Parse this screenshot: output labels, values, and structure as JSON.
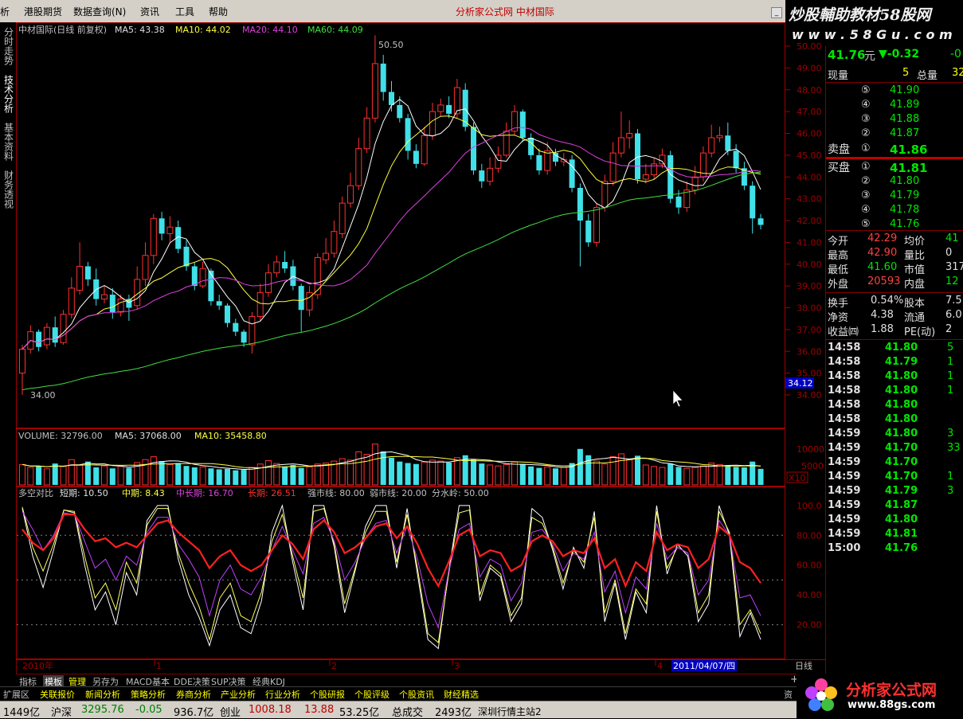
{
  "menu": {
    "items": [
      "析",
      "港股期货",
      "数据查询(N)",
      "资讯",
      "工具",
      "帮助"
    ],
    "center_title": "分析家公式网  中材国际"
  },
  "watermark": {
    "title": "炒股輔助教材58股网",
    "url": "w w w . 5 8 G u . c o m"
  },
  "side_tabs": [
    "分时走势",
    "技术分析",
    "基本资料",
    "财务透视"
  ],
  "main_chart": {
    "header": {
      "name": "中材国际(日线 前复权)",
      "ma5": "MA5: 43.38",
      "ma10": "MA10: 44.02",
      "ma20": "MA20: 44.10",
      "ma60": "MA60: 44.09"
    },
    "high_label": "50.50",
    "low_label": "34.00",
    "cursor_price": "34.12",
    "y_ticks": [
      "50.00",
      "49.00",
      "48.00",
      "47.00",
      "46.00",
      "45.00",
      "44.00",
      "43.00",
      "42.00",
      "41.00",
      "40.00",
      "39.00",
      "38.00",
      "37.00",
      "36.00",
      "35.00",
      "34.00"
    ]
  },
  "volume_chart": {
    "header": {
      "volume": "VOLUME: 32796.00",
      "ma5": "MA5: 37068.00",
      "ma10": "MA10: 35458.80"
    },
    "y_ticks": [
      "10000",
      "5000"
    ],
    "unit": "X10"
  },
  "indicator_chart": {
    "header": {
      "name": "多空对比",
      "short": "短期: 10.50",
      "mid": "中期: 8.43",
      "midlong": "中长期: 16.70",
      "long": "长期: 26.51",
      "strong": "强市线: 80.00",
      "weak": "弱市线: 20.00",
      "watershed": "分水岭: 50.00"
    },
    "y_ticks": [
      "100.0",
      "80.00",
      "60.00",
      "40.00",
      "20.00"
    ]
  },
  "time_axis": {
    "labels": [
      "2010年",
      "1",
      "2",
      "3",
      "4"
    ],
    "cursor_date": "2011/04/07/四",
    "period": "日线"
  },
  "chart_data": {
    "type": "candlestick",
    "ylim": [
      33.2,
      50.6
    ],
    "candles": [
      [
        35.0,
        36.1,
        34.0,
        36.3
      ],
      [
        36.1,
        36.9,
        35.9,
        37.2
      ],
      [
        36.9,
        36.2,
        36.0,
        37.0
      ],
      [
        36.3,
        37.1,
        36.1,
        37.3
      ],
      [
        37.1,
        36.4,
        36.2,
        37.6
      ],
      [
        36.4,
        37.7,
        36.3,
        37.9
      ],
      [
        37.7,
        38.9,
        37.5,
        39.4
      ],
      [
        38.8,
        39.9,
        38.6,
        41.0
      ],
      [
        39.9,
        39.3,
        39.0,
        40.1
      ],
      [
        39.3,
        38.4,
        38.1,
        39.8
      ],
      [
        38.4,
        38.6,
        38.2,
        39.0
      ],
      [
        38.6,
        37.8,
        37.5,
        38.9
      ],
      [
        37.8,
        38.4,
        37.6,
        38.6
      ],
      [
        38.4,
        38.0,
        37.4,
        38.6
      ],
      [
        38.1,
        39.3,
        37.9,
        39.9
      ],
      [
        39.3,
        40.4,
        39.0,
        41.0
      ],
      [
        40.4,
        42.1,
        40.0,
        42.3
      ],
      [
        42.1,
        41.4,
        41.1,
        42.4
      ],
      [
        41.4,
        41.7,
        41.0,
        42.2
      ],
      [
        41.7,
        40.7,
        40.5,
        42.0
      ],
      [
        40.8,
        39.9,
        39.7,
        41.1
      ],
      [
        39.9,
        39.0,
        38.8,
        40.1
      ],
      [
        39.0,
        39.8,
        38.9,
        40.1
      ],
      [
        39.7,
        38.3,
        38.1,
        39.8
      ],
      [
        38.3,
        38.1,
        37.9,
        38.6
      ],
      [
        38.1,
        37.3,
        37.1,
        38.2
      ],
      [
        37.3,
        36.9,
        36.7,
        37.5
      ],
      [
        36.9,
        36.4,
        36.2,
        37.0
      ],
      [
        36.3,
        37.6,
        35.9,
        37.8
      ],
      [
        37.6,
        38.7,
        37.4,
        39.1
      ],
      [
        38.7,
        39.6,
        38.5,
        40.0
      ],
      [
        39.6,
        40.1,
        39.4,
        40.4
      ],
      [
        40.1,
        39.8,
        39.6,
        40.6
      ],
      [
        39.9,
        39.0,
        38.8,
        40.2
      ],
      [
        39.0,
        37.9,
        36.9,
        39.1
      ],
      [
        37.9,
        38.7,
        37.6,
        39.0
      ],
      [
        38.6,
        40.3,
        38.4,
        40.5
      ],
      [
        40.2,
        40.5,
        40.0,
        41.2
      ],
      [
        40.5,
        41.5,
        40.3,
        42.0
      ],
      [
        41.4,
        42.8,
        41.2,
        43.1
      ],
      [
        42.8,
        43.6,
        42.6,
        44.2
      ],
      [
        43.6,
        45.3,
        43.4,
        45.8
      ],
      [
        45.3,
        46.7,
        45.1,
        47.2
      ],
      [
        46.7,
        49.2,
        46.5,
        50.5
      ],
      [
        49.2,
        47.9,
        47.5,
        49.6
      ],
      [
        47.9,
        47.3,
        47.0,
        48.4
      ],
      [
        47.3,
        46.7,
        46.5,
        47.7
      ],
      [
        46.7,
        45.2,
        44.8,
        46.9
      ],
      [
        45.2,
        44.6,
        44.4,
        45.5
      ],
      [
        44.6,
        45.9,
        44.5,
        46.3
      ],
      [
        45.9,
        47.0,
        45.7,
        47.4
      ],
      [
        47.0,
        47.3,
        46.8,
        47.6
      ],
      [
        47.3,
        46.9,
        46.7,
        47.7
      ],
      [
        46.9,
        48.1,
        46.7,
        48.5
      ],
      [
        48.0,
        46.3,
        46.1,
        48.3
      ],
      [
        46.3,
        44.3,
        44.1,
        46.5
      ],
      [
        44.3,
        43.8,
        43.5,
        44.6
      ],
      [
        43.8,
        44.4,
        43.6,
        44.9
      ],
      [
        44.4,
        45.0,
        44.2,
        45.4
      ],
      [
        45.0,
        46.1,
        44.9,
        46.5
      ],
      [
        46.1,
        47.0,
        45.9,
        47.3
      ],
      [
        47.0,
        45.8,
        45.6,
        47.1
      ],
      [
        45.8,
        45.0,
        44.8,
        46.0
      ],
      [
        45.0,
        44.3,
        44.1,
        45.3
      ],
      [
        44.3,
        45.2,
        44.1,
        45.6
      ],
      [
        45.1,
        44.7,
        44.5,
        45.3
      ],
      [
        44.7,
        44.8,
        44.5,
        45.1
      ],
      [
        44.8,
        43.5,
        43.3,
        45.0
      ],
      [
        43.5,
        42.0,
        39.9,
        43.7
      ],
      [
        42.0,
        41.0,
        40.8,
        42.3
      ],
      [
        41.0,
        42.6,
        40.8,
        42.8
      ],
      [
        42.6,
        43.8,
        42.4,
        44.1
      ],
      [
        43.8,
        45.1,
        43.6,
        45.6
      ],
      [
        45.1,
        45.8,
        44.9,
        47.0
      ],
      [
        45.8,
        46.0,
        45.3,
        46.6
      ],
      [
        46.0,
        43.9,
        43.7,
        46.2
      ],
      [
        43.9,
        44.1,
        43.7,
        44.6
      ],
      [
        44.1,
        44.6,
        43.9,
        44.9
      ],
      [
        44.6,
        45.0,
        44.4,
        45.3
      ],
      [
        45.0,
        43.0,
        42.8,
        45.2
      ],
      [
        43.1,
        42.6,
        42.3,
        43.4
      ],
      [
        42.6,
        43.4,
        42.4,
        43.8
      ],
      [
        43.4,
        44.0,
        43.2,
        44.5
      ],
      [
        44.0,
        45.1,
        43.8,
        45.4
      ],
      [
        45.1,
        45.8,
        44.9,
        46.4
      ],
      [
        45.8,
        45.9,
        45.6,
        46.3
      ],
      [
        45.9,
        45.2,
        45.0,
        46.5
      ],
      [
        45.2,
        44.4,
        44.2,
        45.5
      ],
      [
        44.4,
        43.6,
        43.4,
        44.7
      ],
      [
        43.6,
        42.1,
        41.4,
        43.8
      ],
      [
        42.1,
        41.8,
        41.6,
        42.3
      ]
    ],
    "volume": [
      4200,
      3600,
      3900,
      3300,
      4400,
      3800,
      5200,
      4100,
      4800,
      3600,
      3900,
      3400,
      3800,
      3500,
      4600,
      5200,
      5800,
      4900,
      4200,
      4500,
      3900,
      3600,
      3700,
      3400,
      3200,
      3300,
      3000,
      3100,
      3600,
      4300,
      5000,
      4400,
      3800,
      4100,
      3500,
      3700,
      4300,
      4500,
      4900,
      5400,
      5100,
      6800,
      6300,
      8400,
      6900,
      5600,
      4800,
      4500,
      4300,
      4700,
      5100,
      4900,
      4600,
      5600,
      6100,
      5200,
      4400,
      4100,
      3900,
      4200,
      4700,
      4300,
      3800,
      3500,
      3700,
      3400,
      3600,
      4500,
      7400,
      6100,
      4900,
      4300,
      5800,
      6400,
      5200,
      6000,
      4100,
      3800,
      3600,
      4400,
      3700,
      3400,
      3600,
      3900,
      4500,
      4200,
      3900,
      3700,
      3600,
      4800,
      3300
    ],
    "indicator": {
      "short": [
        98,
        66,
        45,
        70,
        97,
        95,
        60,
        30,
        42,
        20,
        55,
        40,
        90,
        100,
        100,
        64,
        40,
        25,
        6,
        30,
        40,
        18,
        14,
        36,
        82,
        100,
        62,
        30,
        100,
        100,
        72,
        28,
        56,
        86,
        100,
        100,
        58,
        98,
        54,
        10,
        4,
        56,
        100,
        100,
        36,
        58,
        52,
        22,
        34,
        98,
        92,
        70,
        44,
        72,
        58,
        96,
        22,
        48,
        10,
        42,
        28,
        100,
        54,
        74,
        66,
        22,
        34,
        100,
        80,
        12,
        28,
        10
      ],
      "mid": [
        99,
        72,
        56,
        74,
        97,
        96,
        66,
        38,
        48,
        30,
        62,
        48,
        87,
        98,
        98,
        68,
        48,
        32,
        10,
        38,
        48,
        26,
        22,
        42,
        76,
        94,
        66,
        38,
        96,
        98,
        74,
        34,
        58,
        82,
        96,
        96,
        62,
        94,
        58,
        14,
        8,
        54,
        95,
        97,
        40,
        60,
        54,
        26,
        38,
        92,
        88,
        72,
        48,
        70,
        62,
        92,
        28,
        50,
        14,
        44,
        34,
        96,
        58,
        72,
        68,
        28,
        40,
        96,
        82,
        20,
        30,
        14
      ],
      "midlong": [
        96,
        84,
        70,
        80,
        95,
        94,
        76,
        58,
        64,
        50,
        66,
        60,
        82,
        92,
        92,
        74,
        64,
        52,
        26,
        50,
        60,
        44,
        40,
        52,
        70,
        86,
        70,
        54,
        88,
        92,
        76,
        50,
        62,
        78,
        88,
        90,
        68,
        86,
        64,
        34,
        18,
        56,
        84,
        88,
        52,
        64,
        60,
        36,
        48,
        82,
        84,
        74,
        56,
        68,
        64,
        82,
        42,
        56,
        28,
        52,
        44,
        88,
        64,
        72,
        68,
        40,
        50,
        90,
        80,
        38,
        40,
        26
      ],
      "long": [
        84,
        75,
        70,
        78,
        94,
        94,
        84,
        76,
        78,
        72,
        75,
        72,
        80,
        88,
        90,
        82,
        76,
        70,
        58,
        66,
        70,
        60,
        56,
        60,
        70,
        80,
        74,
        64,
        84,
        90,
        82,
        68,
        72,
        78,
        86,
        88,
        78,
        86,
        74,
        58,
        46,
        62,
        80,
        84,
        66,
        70,
        68,
        56,
        60,
        76,
        80,
        76,
        66,
        70,
        68,
        78,
        58,
        64,
        46,
        62,
        56,
        82,
        70,
        74,
        72,
        58,
        64,
        86,
        80,
        62,
        58,
        48
      ]
    }
  },
  "quote_panel": {
    "price": "41.76",
    "price_unit": "元",
    "change": "▼-0.32",
    "change_cut": "-0",
    "now_vol_label": "现量",
    "now_vol": "5",
    "total_vol_label": "总量",
    "total_vol": "32",
    "asks": [
      {
        "level": "⑤",
        "price": "41.90"
      },
      {
        "level": "④",
        "price": "41.89"
      },
      {
        "level": "③",
        "price": "41.88"
      },
      {
        "level": "②",
        "price": "41.87"
      },
      {
        "level": "①",
        "price": "41.86"
      }
    ],
    "ask_label": "卖盘",
    "bid_label": "买盘",
    "bids": [
      {
        "level": "①",
        "price": "41.81"
      },
      {
        "level": "②",
        "price": "41.80"
      },
      {
        "level": "③",
        "price": "41.79"
      },
      {
        "level": "④",
        "price": "41.78"
      },
      {
        "level": "⑤",
        "price": "41.76"
      }
    ],
    "stats": [
      {
        "l1": "今开",
        "v1": "42.29",
        "l2": "均价",
        "v2": "41",
        "c1": "red",
        "c2": "green"
      },
      {
        "l1": "最高",
        "v1": "42.90",
        "l2": "量比",
        "v2": "0",
        "c1": "red",
        "c2": "white"
      },
      {
        "l1": "最低",
        "v1": "41.60",
        "l2": "市值",
        "v2": "317.",
        "c1": "green",
        "c2": "white"
      },
      {
        "l1": "外盘",
        "v1": "20593",
        "l2": "内盘",
        "v2": "12",
        "c1": "red",
        "c2": "green"
      }
    ],
    "fin": [
      {
        "l1": "换手",
        "v1": "0.54%",
        "l2": "股本",
        "v2": "7.5"
      },
      {
        "l1": "净资",
        "v1": "4.38",
        "l2": "流通",
        "v2": "6.0"
      },
      {
        "l1": "收益㈣",
        "v1": "1.88",
        "l2": "PE(动)",
        "v2": "2"
      }
    ],
    "ticks": [
      {
        "t": "14:58",
        "p": "41.80",
        "v": "5"
      },
      {
        "t": "14:58",
        "p": "41.79",
        "v": "1"
      },
      {
        "t": "14:58",
        "p": "41.80",
        "v": "1"
      },
      {
        "t": "14:58",
        "p": "41.80",
        "v": "1"
      },
      {
        "t": "14:58",
        "p": "41.80",
        "v": ""
      },
      {
        "t": "14:58",
        "p": "41.80",
        "v": ""
      },
      {
        "t": "14:59",
        "p": "41.80",
        "v": "3"
      },
      {
        "t": "14:59",
        "p": "41.70",
        "v": "33"
      },
      {
        "t": "14:59",
        "p": "41.70",
        "v": ""
      },
      {
        "t": "14:59",
        "p": "41.70",
        "v": "1"
      },
      {
        "t": "14:59",
        "p": "41.79",
        "v": "3"
      },
      {
        "t": "14:59",
        "p": "41.87",
        "v": ""
      },
      {
        "t": "14:59",
        "p": "41.80",
        "v": ""
      },
      {
        "t": "14:59",
        "p": "41.81",
        "v": ""
      },
      {
        "t": "15:00",
        "p": "41.76",
        "v": ""
      }
    ]
  },
  "bottom_tabs": [
    "指标",
    "模板",
    "管理",
    "另存为",
    "MACD基本",
    "DDE决策",
    "SUP决策",
    "经典KDJ"
  ],
  "bottom_plus": "+",
  "func_tabs": [
    "扩展区",
    "关联报价",
    "新闻分析",
    "策略分析",
    "券商分析",
    "产业分析",
    "行业分析",
    "个股研报",
    "个股评级",
    "个股资讯",
    "财经精选"
  ],
  "func_right": "资讯",
  "status": {
    "s1": "1449亿",
    "s2": "沪深",
    "s3": "3295.76",
    "s4": "-0.05",
    "s5": "936.7亿",
    "s6": "创业",
    "s7": "1008.18",
    "s8": "13.88",
    "s9": "53.25亿",
    "s10": "总成交",
    "s11": "2493亿",
    "s12": "深圳行情主站2"
  },
  "ad": {
    "title": "分析家公式网",
    "url": "www.88gs.com"
  },
  "colors": {
    "up": "#ff3030",
    "down": "#40e0e8",
    "ma5": "#ffffff",
    "ma10": "#ffff40",
    "ma20": "#e040e0",
    "ma60": "#40e040",
    "frame": "#a00000"
  }
}
